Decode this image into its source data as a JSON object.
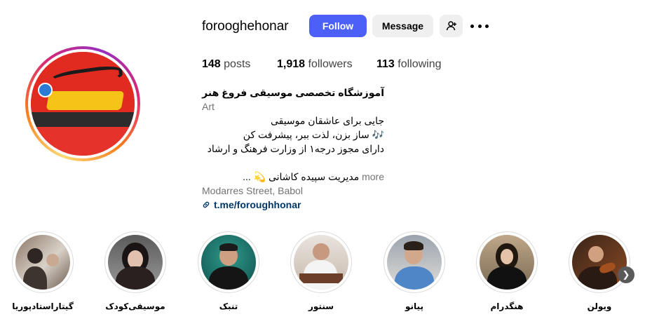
{
  "profile": {
    "username": "forooghehonar",
    "follow_label": "Follow",
    "message_label": "Message",
    "posts_count": "148",
    "posts_label": "posts",
    "followers_count": "1,918",
    "followers_label": "followers",
    "following_count": "113",
    "following_label": "following",
    "display_name": "آموزشگاه تخصصی موسیقی فروغ هنر",
    "category": "Art",
    "bio_lines": [
      "جایی برای عاشقان موسیقی",
      "🎶 ساز بزن، لذت ببر، پیشرفت کن",
      "دارای مجوز درجه۱ از وزارت فرهنگ و ارشاد"
    ],
    "manager_text": "مدیریت سپیده کاشانی 💫 ...",
    "more_label": "more",
    "address": "Modarres Street, Babol",
    "link": "t.me/foroughhonar",
    "accent_color": "#4c5ff6"
  },
  "highlights": [
    {
      "label": "گیتاراستادپوریا"
    },
    {
      "label": "موسیقی‌کودک"
    },
    {
      "label": "تنبک"
    },
    {
      "label": "سنتور"
    },
    {
      "label": "پیانو"
    },
    {
      "label": "هنگدرام"
    },
    {
      "label": "ویولن"
    }
  ]
}
